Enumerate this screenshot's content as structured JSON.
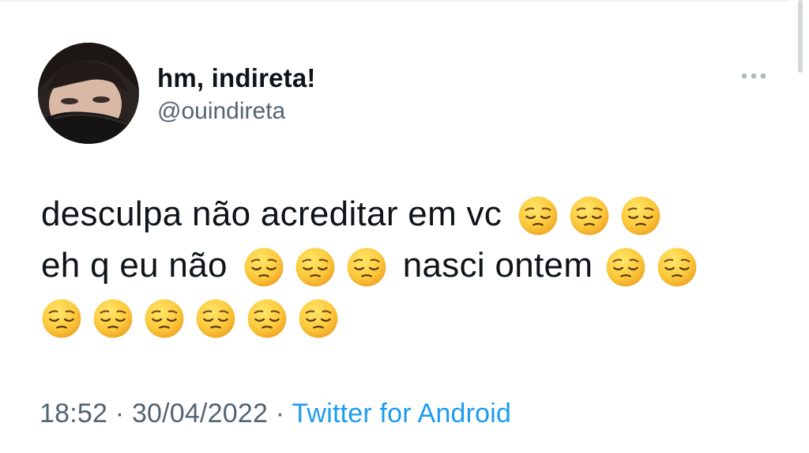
{
  "tweet": {
    "author": {
      "display_name": "hm, indireta!",
      "handle": "@ouindireta",
      "avatar_icon": "profile-photo"
    },
    "more_icon": "ellipsis-icon",
    "text_lines": [
      {
        "text_a": "desculpa não acreditar em vc",
        "emojis_after_a": 3
      },
      {
        "text_a": "eh q eu não",
        "emojis_after_a": 3,
        "text_b": "nasci ontem",
        "emojis_after_b": 2
      },
      {
        "emojis": 6
      }
    ],
    "emoji_name": "pensive-face",
    "meta": {
      "time": "18:52",
      "separator": "·",
      "date": "30/04/2022",
      "source": "Twitter for Android"
    },
    "colors": {
      "text": "#0f1419",
      "secondary": "#536471",
      "link": "#1d9bf0"
    }
  }
}
